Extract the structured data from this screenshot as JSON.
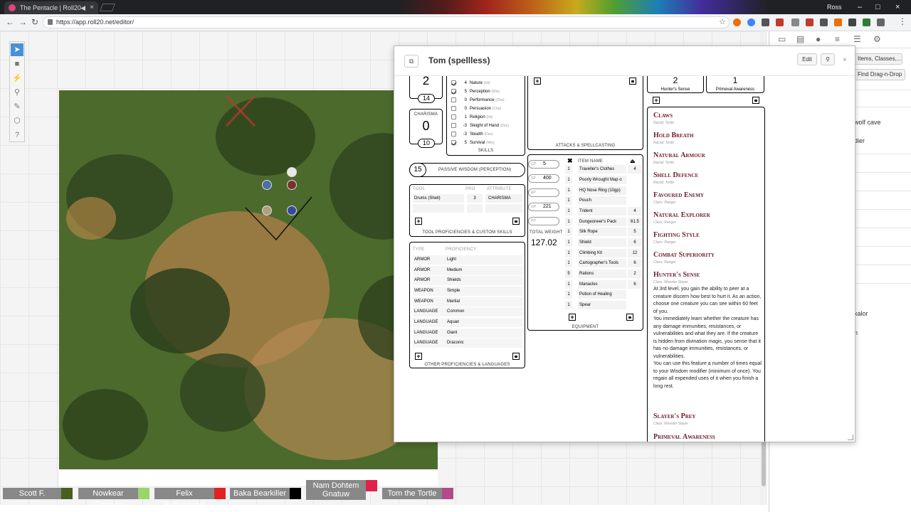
{
  "browser": {
    "tab_title": "The Pentacle | Roll20",
    "url": "https://app.roll20.net/editor/",
    "user": "Ross"
  },
  "sidebar": {
    "btn1": "Items, Classes,...",
    "btn2": "Find Drag-n-Drop",
    "item1": "wolf cave",
    "item2": "dier",
    "item3": "xalor",
    "item4": "n"
  },
  "players": [
    {
      "name": "Scott F.",
      "color": "#4a5e1f"
    },
    {
      "name": "Nowkear Gnatuw",
      "color": "#9bd46a"
    },
    {
      "name": "Felix Belfanduriel",
      "color": "#e02222"
    },
    {
      "name": "Baka Bearkiller",
      "color": "#000000"
    },
    {
      "name": "Nam Dohtem Gnatuw",
      "color": "#e0224a"
    },
    {
      "name": "Tom the Tortle",
      "color": "#b44a8a"
    }
  ],
  "dialog": {
    "title": "Tom (spellless)",
    "edit": "Edit",
    "col1": {
      "top_score": "2",
      "top_mod": "14",
      "cha_label": "CHARISMA",
      "cha_score": "0",
      "cha_mod": "10",
      "skills": [
        {
          "mod": "4",
          "name": "Nature",
          "attr": "(Int)",
          "checked": true
        },
        {
          "mod": "5",
          "name": "Perception",
          "attr": "(Wis)",
          "checked": true
        },
        {
          "mod": "0",
          "name": "Performance",
          "attr": "(Cha)",
          "checked": false
        },
        {
          "mod": "0",
          "name": "Persuasion",
          "attr": "(Cha)",
          "checked": false
        },
        {
          "mod": "1",
          "name": "Religion",
          "attr": "(Int)",
          "checked": false
        },
        {
          "mod": "-3",
          "name": "Sleight of Hand",
          "attr": "(Dex)",
          "checked": false
        },
        {
          "mod": "-3",
          "name": "Stealth",
          "attr": "(Dex)",
          "checked": false
        },
        {
          "mod": "5",
          "name": "Survival",
          "attr": "(Wis)",
          "checked": true
        }
      ],
      "skills_label": "SKILLS",
      "passive_val": "15",
      "passive_label": "PASSIVE WISDOM (PERCEPTION)",
      "tool_hdr": {
        "tool": "TOOL",
        "pro": "PRO",
        "attr": "ATTRIBUTE"
      },
      "tool_row": {
        "tool": "Drums (Shell)",
        "pro": "3",
        "attr": "CHARISMA"
      },
      "tool_label": "TOOL PROFICIENCIES & CUSTOM SKILLS",
      "prof_hdr": {
        "type": "TYPE",
        "name": "PROFICIENCY"
      },
      "profs": [
        {
          "type": "ARMOR",
          "name": "Light"
        },
        {
          "type": "ARMOR",
          "name": "Medium"
        },
        {
          "type": "ARMOR",
          "name": "Shields"
        },
        {
          "type": "WEAPON",
          "name": "Simple"
        },
        {
          "type": "WEAPON",
          "name": "Martial"
        },
        {
          "type": "LANGUAGE",
          "name": "Common"
        },
        {
          "type": "LANGUAGE",
          "name": "Aquan"
        },
        {
          "type": "LANGUAGE",
          "name": "Giant"
        },
        {
          "type": "LANGUAGE",
          "name": "Draconic"
        }
      ],
      "prof_label": "OTHER PROFICIENCIES & LANGUAGES"
    },
    "col2": {
      "attacks_label": "ATTACKS & SPELLCASTING",
      "coins": [
        {
          "lbl": "CP",
          "val": "5"
        },
        {
          "lbl": "SP",
          "val": "400"
        },
        {
          "lbl": "EP",
          "val": ""
        },
        {
          "lbl": "GP",
          "val": "221"
        },
        {
          "lbl": "PP",
          "val": ""
        }
      ],
      "total_weight_label": "TOTAL WEIGHT",
      "total_weight": "127.02",
      "item_name_hdr": "ITEM NAME",
      "items": [
        {
          "q": "1",
          "n": "Traveller's Clothes",
          "w": "4"
        },
        {
          "q": "1",
          "n": "Poorly Wrought Map o",
          "w": ""
        },
        {
          "q": "1",
          "n": "HQ Nose Ring (10gp)",
          "w": ""
        },
        {
          "q": "1",
          "n": "Pouch",
          "w": ""
        },
        {
          "q": "1",
          "n": "Trident",
          "w": "4"
        },
        {
          "q": "1",
          "n": "Dungeoneer's Pack",
          "w": "61.5"
        },
        {
          "q": "1",
          "n": "Silk Rope",
          "w": "5"
        },
        {
          "q": "1",
          "n": "Shield",
          "w": "6"
        },
        {
          "q": "1",
          "n": "Climbing Kit",
          "w": "12"
        },
        {
          "q": "1",
          "n": "Cartographer's Tools",
          "w": "6"
        },
        {
          "q": "5",
          "n": "Rations",
          "w": "2"
        },
        {
          "q": "1",
          "n": "Manacles",
          "w": "6"
        },
        {
          "q": "1",
          "n": "Potion of Healing",
          "w": ""
        },
        {
          "q": "1",
          "n": "Spear",
          "w": ""
        }
      ],
      "equipment_label": "EQUIPMENT"
    },
    "col3": {
      "res1_val": "2",
      "res1_label": "Hunter's Sense",
      "res2_val": "1",
      "res2_label": "Primeval Awareness",
      "features": [
        {
          "name": "Claws",
          "src": "Racial: Tortle"
        },
        {
          "name": "Hold Breath",
          "src": "Racial: Tortle"
        },
        {
          "name": "Natural Armour",
          "src": "Racial: Tortle"
        },
        {
          "name": "Shell Defence",
          "src": "Racial: Tortle"
        },
        {
          "name": "Favoured Enemy",
          "src": "Class: Ranger"
        },
        {
          "name": "Natural Explorer",
          "src": "Class: Ranger"
        },
        {
          "name": "Fighting Style",
          "src": "Class: Ranger"
        },
        {
          "name": "Combat Superiority",
          "src": "Class: Ranger"
        },
        {
          "name": "Hunter's Sense",
          "src": "Class: Monster Slayer"
        }
      ],
      "hs_desc": "At 3rd level, you gain the ability to peer at a creature discern how best to hurt it. As an action, choose one creature you can see within 60 feet of you.\nYou immediately learn whether the creature has any damage immunities, resistances, or vulnerabilities and what they are. If the creature is hidden from divination magic, you sense that it has no damage immunities, resistances, or vulnerabilities.\nYou can use this feature a number of times equal to your Wisdom modifier (minimum of once). You regain all expended uses of it when you finish a long rest.",
      "slayer_name": "Slayer's Prey",
      "slayer_src": "Class: Monster Slayer",
      "last_name": "Primeval Awareness"
    }
  }
}
